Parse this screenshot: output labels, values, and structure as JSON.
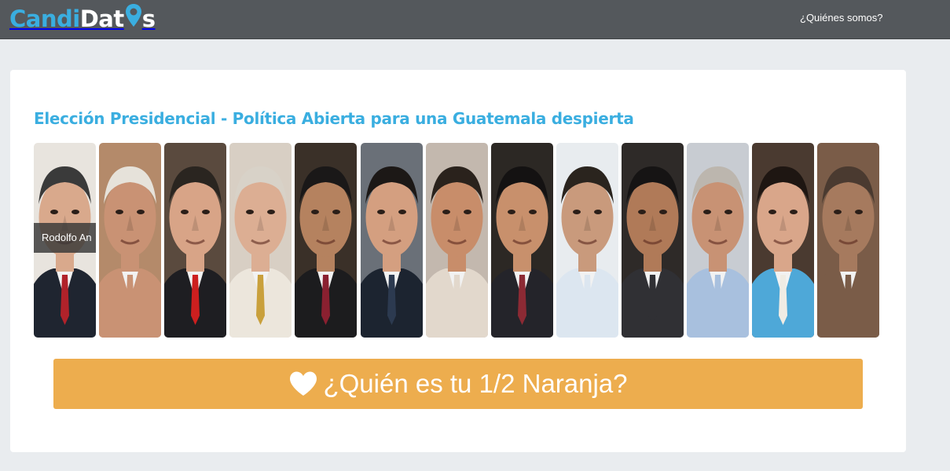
{
  "brand": {
    "part1": "Candi",
    "part2": "Dat",
    "part3": "s"
  },
  "nav": {
    "about_label": "¿Quiénes somos?"
  },
  "main": {
    "title": "Elección Presidencial - Política Abierta para una Guatemala despierta",
    "cta_label": "¿Quién es tu 1/2 Naranja?"
  },
  "candidates": [
    {
      "name": "Rodolfo An",
      "skin": "#d9a98c",
      "bg": "#e8e4de",
      "suit": "#1f2530",
      "tie": "#b0222a",
      "hair": "#3a3a3a"
    },
    {
      "skin": "#c99274",
      "bg": "#b48a6a",
      "suit": "#c99274",
      "tie": "#c99274",
      "hair": "#e6e2da"
    },
    {
      "skin": "#d8a487",
      "bg": "#5a4a3e",
      "suit": "#1e1e22",
      "tie": "#cc1f1f",
      "hair": "#2a2520"
    },
    {
      "skin": "#dcae93",
      "bg": "#d8cfc4",
      "suit": "#ece6dc",
      "tie": "#c9a03c",
      "hair": "#d8d2c8"
    },
    {
      "skin": "#b5825f",
      "bg": "#3a3028",
      "suit": "#1c1c1e",
      "tie": "#8a2030",
      "hair": "#1a1818"
    },
    {
      "skin": "#d49f80",
      "bg": "#6a7078",
      "suit": "#1c2430",
      "tie": "#2c3a50",
      "hair": "#1c1816"
    },
    {
      "skin": "#c88d6a",
      "bg": "#c3b8ae",
      "suit": "#e2d8cc",
      "tie": "#e2d8cc",
      "hair": "#2a221c"
    },
    {
      "skin": "#c8906c",
      "bg": "#2c2824",
      "suit": "#24242a",
      "tie": "#8c2a34",
      "hair": "#141212"
    },
    {
      "skin": "#c99a7c",
      "bg": "#e8ecef",
      "suit": "#dce6f0",
      "tie": "#dce6f0",
      "hair": "#2a241e"
    },
    {
      "skin": "#b07a58",
      "bg": "#2e2a28",
      "suit": "#303034",
      "tie": "#303034",
      "hair": "#161414"
    },
    {
      "skin": "#c89274",
      "bg": "#c8ccd2",
      "suit": "#a8c0de",
      "tie": "#a8c0de",
      "hair": "#bcb6ae"
    },
    {
      "skin": "#d9a68a",
      "bg": "#4a3a30",
      "suit": "#4ea8d8",
      "tie": "#f0ece4",
      "hair": "#1e1612"
    },
    {
      "skin": "#a67a5e",
      "bg": "#7a5c48",
      "suit": "#7a5c48",
      "tie": "#7a5c48",
      "hair": "#4a3a30"
    }
  ],
  "icons": {
    "heart": "heart-icon",
    "pin": "map-pin-icon"
  },
  "colors": {
    "brand_blue": "#3aaee0",
    "navbar": "#54585c",
    "cta": "#edad4e",
    "background": "#e9ecef"
  }
}
